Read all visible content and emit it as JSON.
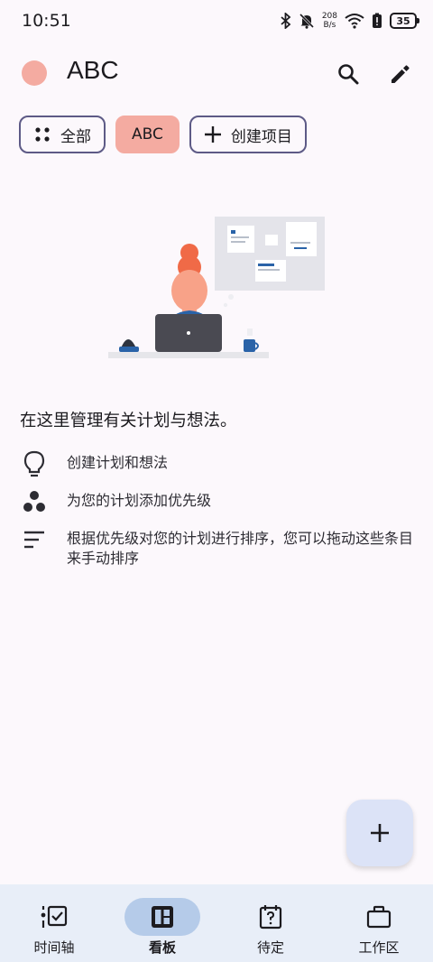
{
  "status_bar": {
    "time": "10:51",
    "net_speed_value": "208",
    "net_speed_unit": "B/s",
    "battery": "35",
    "icons": [
      "bluetooth-icon",
      "mute-icon",
      "wifi-icon",
      "battery-alert-icon",
      "battery-icon"
    ]
  },
  "app_bar": {
    "title": "ABC",
    "project_color": "#f4aba1",
    "actions": [
      "search-icon",
      "edit-icon"
    ]
  },
  "chips": {
    "all_label": "全部",
    "project_label": "ABC",
    "create_label": "创建项目"
  },
  "empty_state": {
    "headline": "在这里管理有关计划与想法。",
    "tips": [
      {
        "icon": "lightbulb-icon",
        "text": "创建计划和想法"
      },
      {
        "icon": "priority-icon",
        "text": "为您的计划添加优先级"
      },
      {
        "icon": "sort-icon",
        "text": "根据优先级对您的计划进行排序，您可以拖动这些条目来手动排序"
      }
    ]
  },
  "fab": {
    "icon": "plus-icon"
  },
  "bottom_nav": {
    "items": [
      {
        "label": "时间轴",
        "icon": "timeline-icon",
        "active": false
      },
      {
        "label": "看板",
        "icon": "board-icon",
        "active": true
      },
      {
        "label": "待定",
        "icon": "pending-icon",
        "active": false
      },
      {
        "label": "工作区",
        "icon": "workspace-icon",
        "active": false
      }
    ]
  },
  "colors": {
    "background": "#fcf8fc",
    "accent_chip": "#f4aba1",
    "chip_border": "#5d5a86",
    "nav_background": "#e8eef8",
    "nav_active": "#b5cbe9",
    "fab": "#dce3f7"
  }
}
